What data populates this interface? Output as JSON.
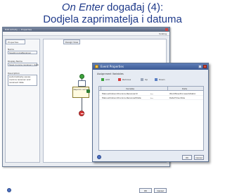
{
  "slide": {
    "title_event": "On Enter",
    "title_rest": " događaj (4):",
    "subtitle": "Dodjela zaprimatelja i datuma"
  },
  "editor": {
    "title": "Edit Activity — Properties",
    "toolbar_label": "Scaling",
    "left_tab": "Properties",
    "right_tab": "Design View",
    "fields": [
      {
        "label": "Name",
        "value": "SaveInvoiceReceiver"
      },
      {
        "label": "Display Name",
        "value": "Save invoice receiver / date"
      },
      {
        "label": "Description",
        "value": "Automatically saves invoice receiver and received date"
      }
    ],
    "task_label": "Zaprimi račun",
    "ok_label": "OK",
    "cancel_label": "Cancel"
  },
  "dialog": {
    "title": "Event Properties",
    "section_label": "Assignment Variables",
    "actions": {
      "add": "Add",
      "remove": "Remove",
      "up": "Up",
      "down": "Down"
    },
    "table": {
      "headers": [
        "Variable",
        "Data"
      ],
      "rows": [
        {
          "variable": "ManualInboundInvoice.ReceiverId",
          "arrow": "⟵",
          "data": "Workflow.ProcessInitiator"
        },
        {
          "variable": "ManualInboundInvoice.ReceivedDate",
          "arrow": "⟵",
          "data": "DateTime.Now"
        }
      ]
    },
    "ok_label": "OK",
    "cancel_label": "Cancel"
  },
  "colors": {
    "title_blue": "#1f3a8a",
    "start_green": "#3ca33c",
    "stop_red": "#d93a3a"
  }
}
